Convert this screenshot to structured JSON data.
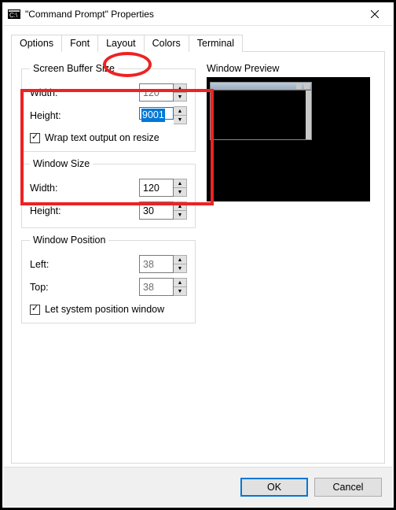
{
  "window": {
    "title": "\"Command Prompt\" Properties"
  },
  "tabs": {
    "options": "Options",
    "font": "Font",
    "layout": "Layout",
    "colors": "Colors",
    "terminal": "Terminal",
    "active": "layout"
  },
  "buffer": {
    "legend": "Screen Buffer Size",
    "width_label": "Width:",
    "width_value": "120",
    "height_label": "Height:",
    "height_value": "9001",
    "wrap_label": "Wrap text output on resize",
    "wrap_checked": true
  },
  "winsize": {
    "legend": "Window Size",
    "width_label": "Width:",
    "width_value": "120",
    "height_label": "Height:",
    "height_value": "30"
  },
  "winpos": {
    "legend": "Window Position",
    "left_label": "Left:",
    "left_value": "38",
    "top_label": "Top:",
    "top_value": "38",
    "let_system_label": "Let system position window",
    "let_system_checked": true
  },
  "preview": {
    "label": "Window Preview"
  },
  "buttons": {
    "ok": "OK",
    "cancel": "Cancel"
  }
}
